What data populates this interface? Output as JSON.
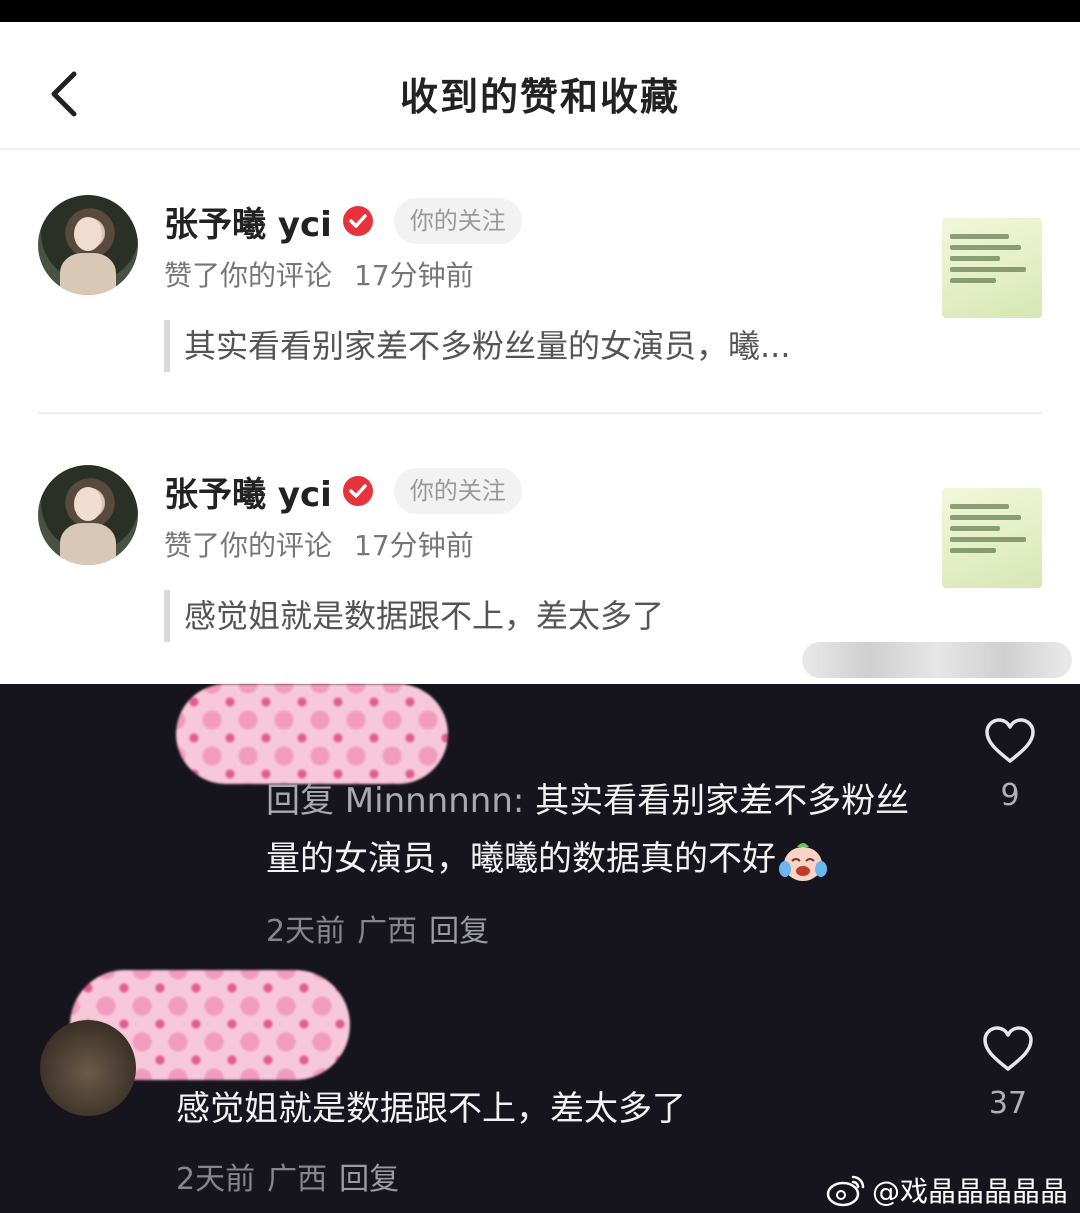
{
  "nav": {
    "title": "收到的赞和收藏"
  },
  "notifications": [
    {
      "user": "张予曦 yci",
      "badge": "你的关注",
      "action": "赞了你的评论",
      "time": "17分钟前",
      "quote": "其实看看别家差不多粉丝量的女演员，曦..."
    },
    {
      "user": "张予曦 yci",
      "badge": "你的关注",
      "action": "赞了你的评论",
      "time": "17分钟前",
      "quote": "感觉姐就是数据跟不上，差太多了"
    }
  ],
  "comments": [
    {
      "reply_prefix": "回复 Minnnnnn:",
      "text": " 其实看看别家差不多粉丝量的女演员，曦曦的数据真的不好",
      "age": "2天前",
      "location": "广西",
      "reply_label": "回复",
      "likes": "9"
    },
    {
      "text": "感觉姐就是数据跟不上，差太多了",
      "age": "2天前",
      "location": "广西",
      "reply_label": "回复",
      "likes": "37"
    }
  ],
  "footer": {
    "watermark": "@戏晶晶晶晶晶"
  },
  "colors": {
    "verified": "#e8323c",
    "dark_bg": "#16151d",
    "censor_pink": "#f29bbd"
  }
}
